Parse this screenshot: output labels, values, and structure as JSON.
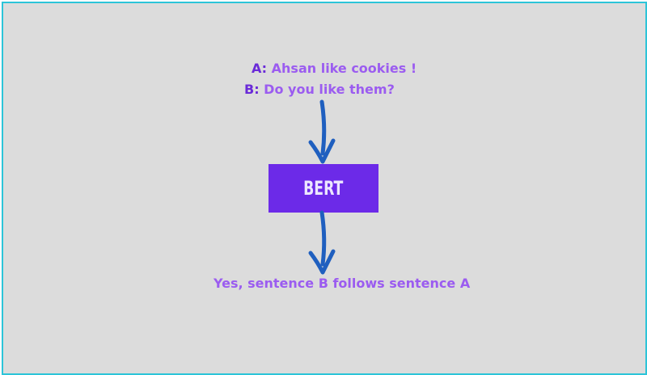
{
  "input": {
    "a_tag": "A:",
    "a_text": "Ahsan like cookies !",
    "b_tag": "B:",
    "b_text": "Do you like them?"
  },
  "model": {
    "label": "BERT"
  },
  "output": {
    "text": "Yes, sentence B follows sentence A"
  },
  "colors": {
    "frame_border": "#2cc4d8",
    "background": "#dcdcdc",
    "tag": "#6a2ad8",
    "text": "#9b5cf0",
    "box": "#6c2ae8",
    "arrow": "#1f5fbf"
  }
}
